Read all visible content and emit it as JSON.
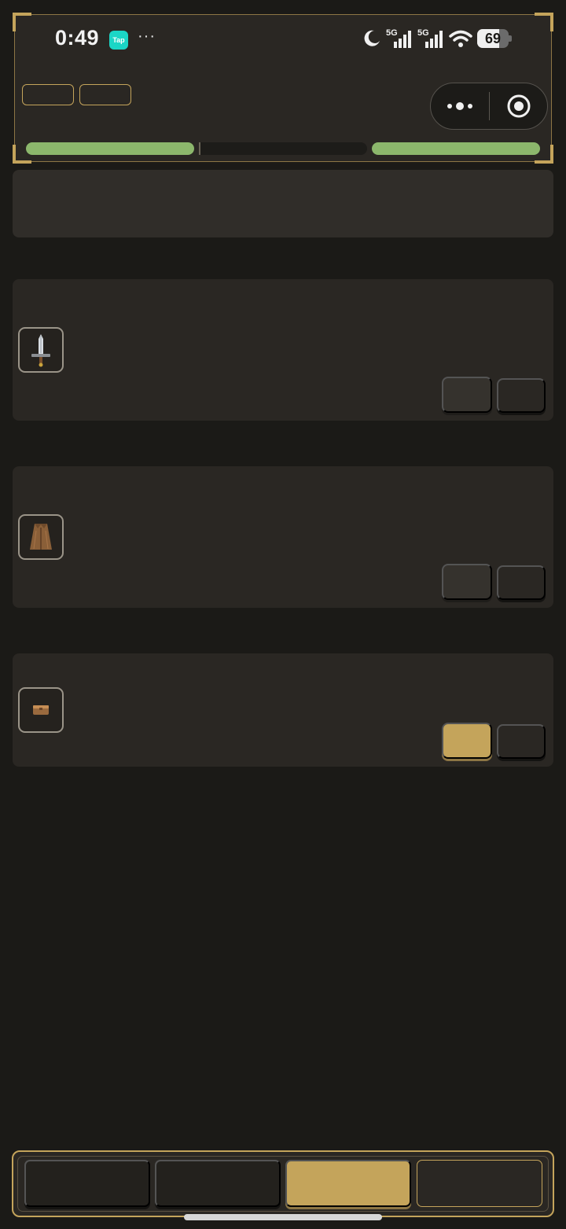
{
  "status_bar": {
    "time": "0:49",
    "app_badge": "Tap",
    "more": "···",
    "network_1": "5G",
    "network_2": "5G",
    "battery_percent": "69",
    "battery_level": 0.69
  },
  "hud": {
    "progress": [
      1.0,
      0.0,
      1.0
    ],
    "accent_color": "#c4a45b",
    "bar_color": "#8cb76c"
  },
  "equipment": [
    {
      "slot_icon": "sword-icon"
    },
    {
      "slot_icon": "cloak-armor-icon"
    },
    {
      "slot_icon": "pouch-icon"
    }
  ],
  "nav": {
    "active_tab_index": 2,
    "tab_count": 4
  }
}
